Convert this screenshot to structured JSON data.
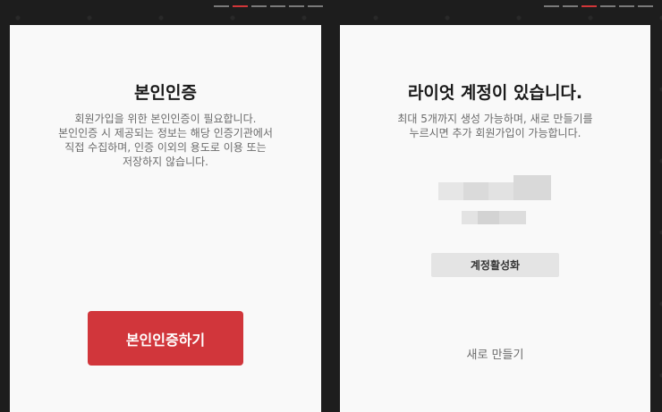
{
  "verification_panel": {
    "title": "본인인증",
    "description_lines": [
      "회원가입을 위한 본인인증이 필요합니다.",
      "본인인증 시 제공되는 정보는 해당 인증기관에서",
      "직접 수집하며, 인증 이외의 용도로 이용 또는",
      "저장하지 않습니다."
    ],
    "button_label": "본인인증하기",
    "active_step": 2,
    "total_steps": 6
  },
  "account_panel": {
    "title": "라이엇 계정이 있습니다.",
    "description_lines": [
      "최대 5개까지 생성 가능하며, 새로 만들기를",
      "누르시면 추가 회원가입이 가능합니다."
    ],
    "activate_button_label": "계정활성화",
    "create_new_label": "새로 만들기",
    "active_step": 3,
    "total_steps": 6
  },
  "colors": {
    "accent": "#d1363b",
    "panel_bg": "#f9f9f9",
    "page_bg": "#1d1d1d"
  }
}
